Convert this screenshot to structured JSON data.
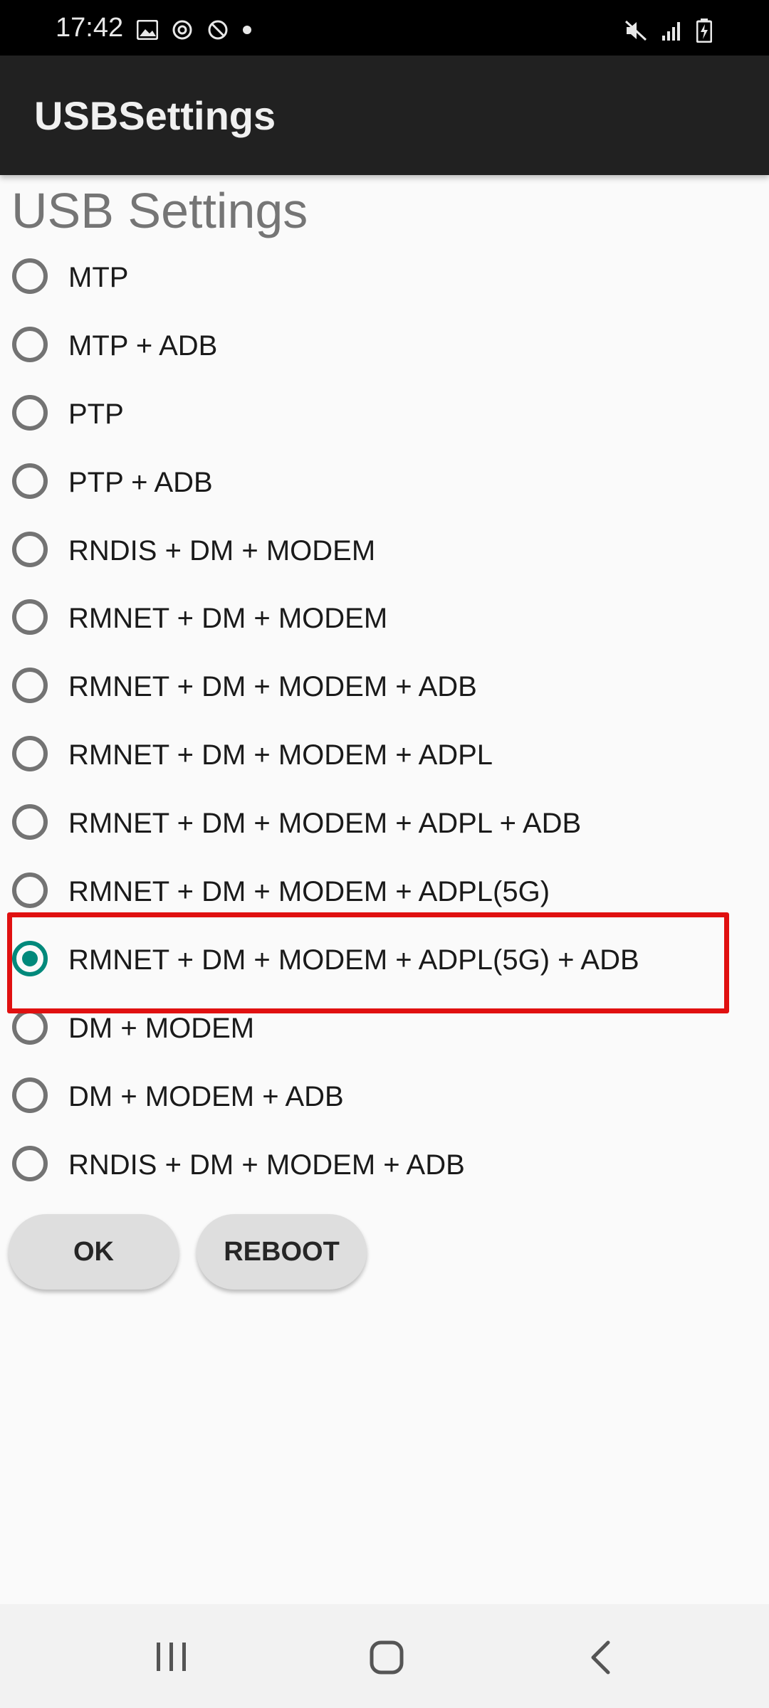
{
  "status_bar": {
    "time": "17:42",
    "left_icons": [
      "image-icon",
      "sync-icon",
      "blocked-icon",
      "dot-icon"
    ],
    "right_icons": [
      "mute-icon",
      "signal-icon",
      "battery-charging-icon"
    ]
  },
  "app_bar": {
    "title": "USBSettings"
  },
  "page": {
    "title": "USB Settings"
  },
  "options": [
    {
      "label": "MTP",
      "checked": false
    },
    {
      "label": "MTP + ADB",
      "checked": false
    },
    {
      "label": "PTP",
      "checked": false
    },
    {
      "label": "PTP + ADB",
      "checked": false
    },
    {
      "label": "RNDIS + DM + MODEM",
      "checked": false
    },
    {
      "label": "RMNET + DM + MODEM",
      "checked": false
    },
    {
      "label": "RMNET + DM + MODEM + ADB",
      "checked": false
    },
    {
      "label": "RMNET + DM + MODEM + ADPL",
      "checked": false
    },
    {
      "label": "RMNET + DM + MODEM + ADPL + ADB",
      "checked": false
    },
    {
      "label": "RMNET + DM + MODEM + ADPL(5G)",
      "checked": false
    },
    {
      "label": "RMNET + DM + MODEM + ADPL(5G) + ADB",
      "checked": true
    },
    {
      "label": "DM + MODEM",
      "checked": false
    },
    {
      "label": "DM + MODEM + ADB",
      "checked": false
    },
    {
      "label": "RNDIS + DM + MODEM + ADB",
      "checked": false
    }
  ],
  "buttons": {
    "ok": "OK",
    "reboot": "REBOOT"
  },
  "colors": {
    "accent": "#00897b",
    "highlight": "#e01010",
    "app_bar": "#212121"
  },
  "nav_bar": {
    "icons": [
      "recents-icon",
      "home-icon",
      "back-icon"
    ]
  }
}
